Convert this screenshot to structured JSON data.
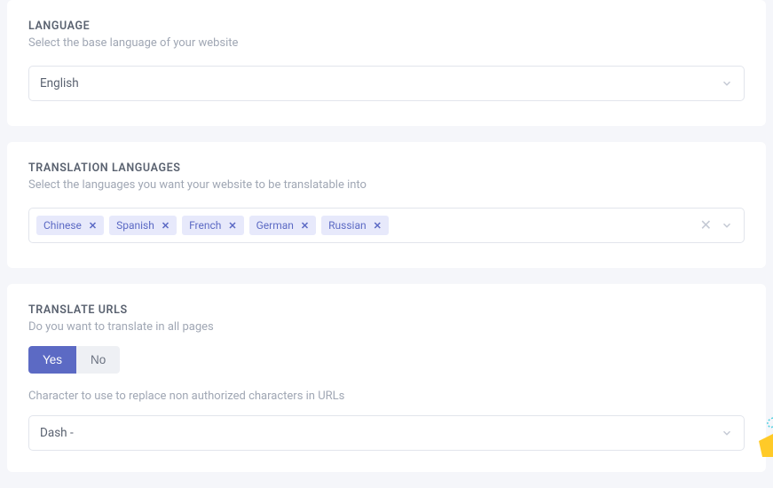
{
  "language": {
    "title": "LANGUAGE",
    "subtitle": "Select the base language of your website",
    "selected": "English"
  },
  "translation": {
    "title": "TRANSLATION LANGUAGES",
    "subtitle": "Select the languages you want your website to be translatable into",
    "tags": [
      "Chinese",
      "Spanish",
      "French",
      "German",
      "Russian"
    ]
  },
  "urls": {
    "title": "TRANSLATE URLS",
    "question": "Do you want to translate in all pages",
    "yes": "Yes",
    "no": "No",
    "char_label": "Character to use to replace non authorized characters in URLs",
    "selected": "Dash -"
  }
}
